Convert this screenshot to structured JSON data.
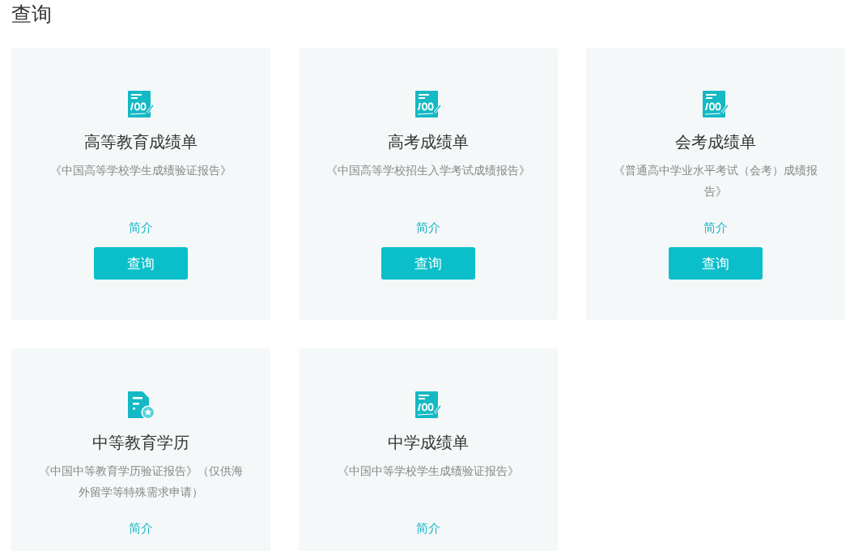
{
  "page_title": "查询",
  "cards": [
    {
      "kind": "score",
      "title": "高等教育成绩单",
      "subtitle": "《中国高等学校学生成绩验证报告》",
      "link": "简介",
      "button": "查询"
    },
    {
      "kind": "score",
      "title": "高考成绩单",
      "subtitle": "《中国高等学校招生入学考试成绩报告》",
      "link": "简介",
      "button": "查询"
    },
    {
      "kind": "score",
      "title": "会考成绩单",
      "subtitle": "《普通高中学业水平考试（会考）成绩报告》",
      "link": "简介",
      "button": "查询"
    },
    {
      "kind": "certificate",
      "title": "中等教育学历",
      "subtitle": "《中国中等教育学历验证报告》（仅供海外留学等特殊需求申请）",
      "link": "简介"
    },
    {
      "kind": "score",
      "title": "中学成绩单",
      "subtitle": "《中国中等学校学生成绩验证报告》",
      "link": "简介"
    }
  ]
}
